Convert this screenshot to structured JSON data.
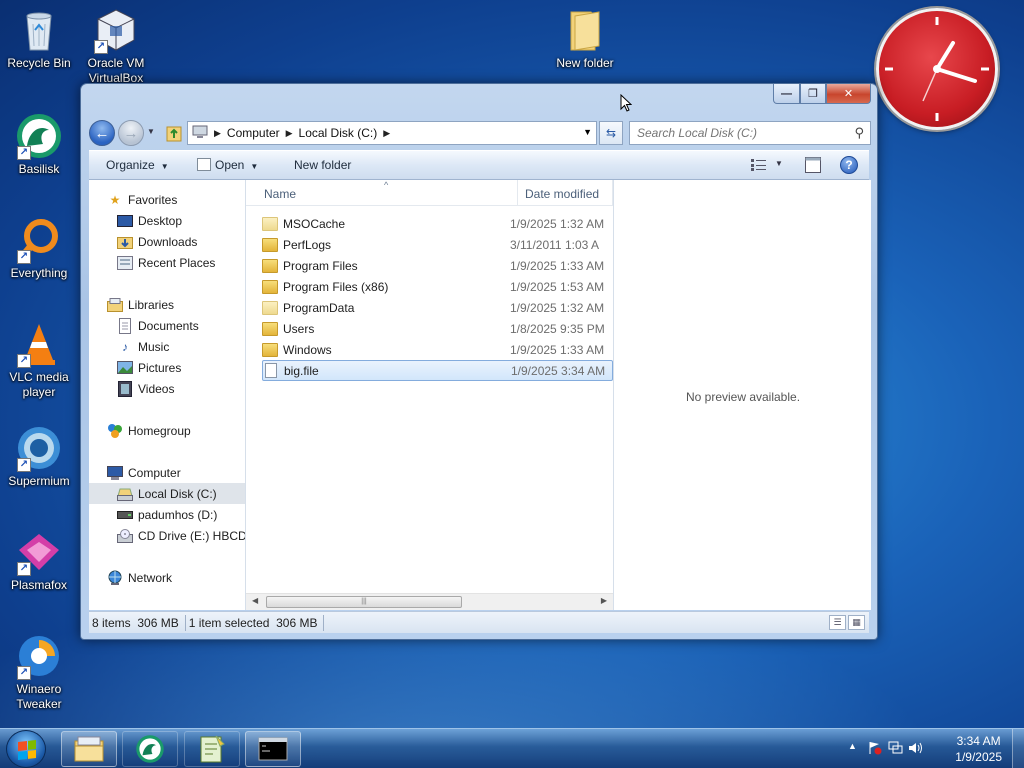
{
  "desktop": {
    "icons": [
      {
        "label": "Recycle Bin"
      },
      {
        "label": "Oracle VM VirtualBox"
      },
      {
        "label": "New folder"
      },
      {
        "label": "Basilisk"
      },
      {
        "label": "Everything"
      },
      {
        "label": "VLC media player"
      },
      {
        "label": "Supermium"
      },
      {
        "label": "Plasmafox"
      },
      {
        "label": "Winaero Tweaker"
      }
    ]
  },
  "window": {
    "controls": {
      "minimize": "—",
      "maximize": "❐",
      "close": "✕"
    },
    "address": {
      "crumbs": [
        "Computer",
        "Local Disk (C:)"
      ]
    },
    "search": {
      "placeholder": "Search Local Disk (C:)"
    },
    "toolbar": {
      "organize": "Organize",
      "open": "Open",
      "new_folder": "New folder"
    },
    "nav": {
      "favorites": "Favorites",
      "desktop": "Desktop",
      "downloads": "Downloads",
      "recent": "Recent Places",
      "libraries": "Libraries",
      "documents": "Documents",
      "music": "Music",
      "pictures": "Pictures",
      "videos": "Videos",
      "homegroup": "Homegroup",
      "computer": "Computer",
      "local_disk": "Local Disk (C:)",
      "padumhos": "padumhos (D:)",
      "cd_drive": "CD Drive (E:) HBCD_",
      "network": "Network"
    },
    "columns": {
      "name": "Name",
      "date": "Date modified"
    },
    "files": [
      {
        "name": "MSOCache",
        "date": "1/9/2025 1:32 AM",
        "type": "folder-light"
      },
      {
        "name": "PerfLogs",
        "date": "3/11/2011 1:03 A",
        "type": "folder"
      },
      {
        "name": "Program Files",
        "date": "1/9/2025 1:33 AM",
        "type": "folder"
      },
      {
        "name": "Program Files (x86)",
        "date": "1/9/2025 1:53 AM",
        "type": "folder"
      },
      {
        "name": "ProgramData",
        "date": "1/9/2025 1:32 AM",
        "type": "folder-light"
      },
      {
        "name": "Users",
        "date": "1/8/2025 9:35 PM",
        "type": "folder"
      },
      {
        "name": "Windows",
        "date": "1/9/2025 1:33 AM",
        "type": "folder"
      },
      {
        "name": "big.file",
        "date": "1/9/2025 3:34 AM",
        "type": "file"
      }
    ],
    "preview": {
      "message": "No preview available."
    },
    "status": {
      "items": "8 items",
      "items_size": "306 MB",
      "selected": "1 item selected",
      "selected_size": "306 MB"
    }
  },
  "taskbar": {
    "clock_time": "3:34 AM",
    "clock_date": "1/9/2025"
  }
}
